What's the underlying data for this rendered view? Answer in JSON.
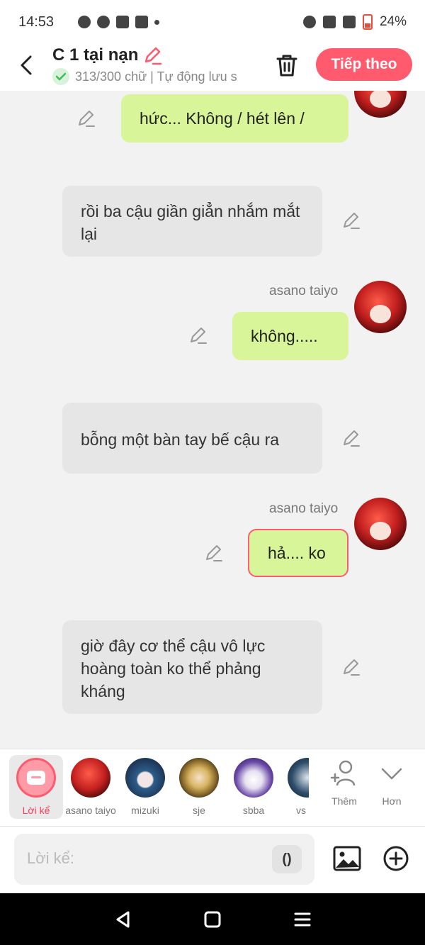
{
  "status_bar": {
    "time": "14:53",
    "battery": "24%"
  },
  "header": {
    "title": "C 1 tại nạn",
    "subtitle": "313/300 chữ | Tự động lưu s",
    "next_label": "Tiếp theo"
  },
  "messages": [
    {
      "type": "right",
      "text": "hức... Không / hét lên /"
    },
    {
      "type": "left",
      "text": "rồi ba cậu giần giẳn nhắm mắt lại"
    },
    {
      "type": "right",
      "speaker": "asano taiyo",
      "text": "không....."
    },
    {
      "type": "left",
      "text": "bỗng một bàn tay bế cậu ra"
    },
    {
      "type": "right",
      "speaker": "asano taiyo",
      "text": "hả.... ko",
      "selected": true
    },
    {
      "type": "left",
      "text": "giờ đây cơ thể cậu vô lực hoàng toàn ko thể phảng kháng"
    }
  ],
  "characters": [
    {
      "label": "Lời kể",
      "active": true
    },
    {
      "label": "asano taiyo"
    },
    {
      "label": "mizuki"
    },
    {
      "label": "sje"
    },
    {
      "label": "sbba"
    },
    {
      "label": "vs"
    }
  ],
  "tools": {
    "add_label": "Thêm",
    "more_label": "Hơn"
  },
  "input": {
    "placeholder": "Lời kể:",
    "paren_label": "()"
  },
  "colors": {
    "accent": "#ff5a6e",
    "right_bubble": "#d9f59a",
    "left_bubble": "#e6e6e6"
  }
}
